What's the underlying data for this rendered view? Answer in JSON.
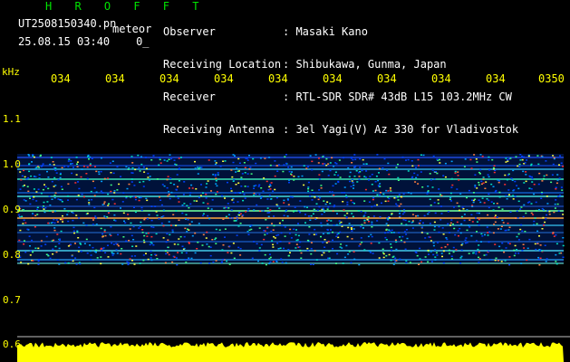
{
  "header": {
    "title": "H R O F F T",
    "filename": "UT2508150340.pn",
    "mode": "meteor",
    "datetime": "25.08.15 03:40",
    "datetime_suffix": "0_",
    "fields": [
      {
        "label": "Observer",
        "value": ": Masaki Kano"
      },
      {
        "label": "Receiving Location",
        "value": ": Shibukawa, Gunma, Japan"
      },
      {
        "label": "Receiver",
        "value": ": RTL-SDR SDR# 43dB L15 103.2MHz CW"
      },
      {
        "label": "Receiving Antenna",
        "value": ": 3el Yagi(V) Az 330 for Vladivostok"
      }
    ]
  },
  "axis": {
    "unit": "kHz",
    "y_ticks": [
      "1.1",
      "1.0",
      "0.9",
      "0.8",
      "0.7",
      "0.6"
    ],
    "time_ticks": [
      "034",
      "034",
      "034",
      "034",
      "034",
      "034",
      "034",
      "034",
      "034",
      "0350"
    ]
  },
  "colors": {
    "background": "#000000",
    "axis_text": "#ffff00",
    "title": "#00e400",
    "signal_floor": "#ffff00"
  }
}
